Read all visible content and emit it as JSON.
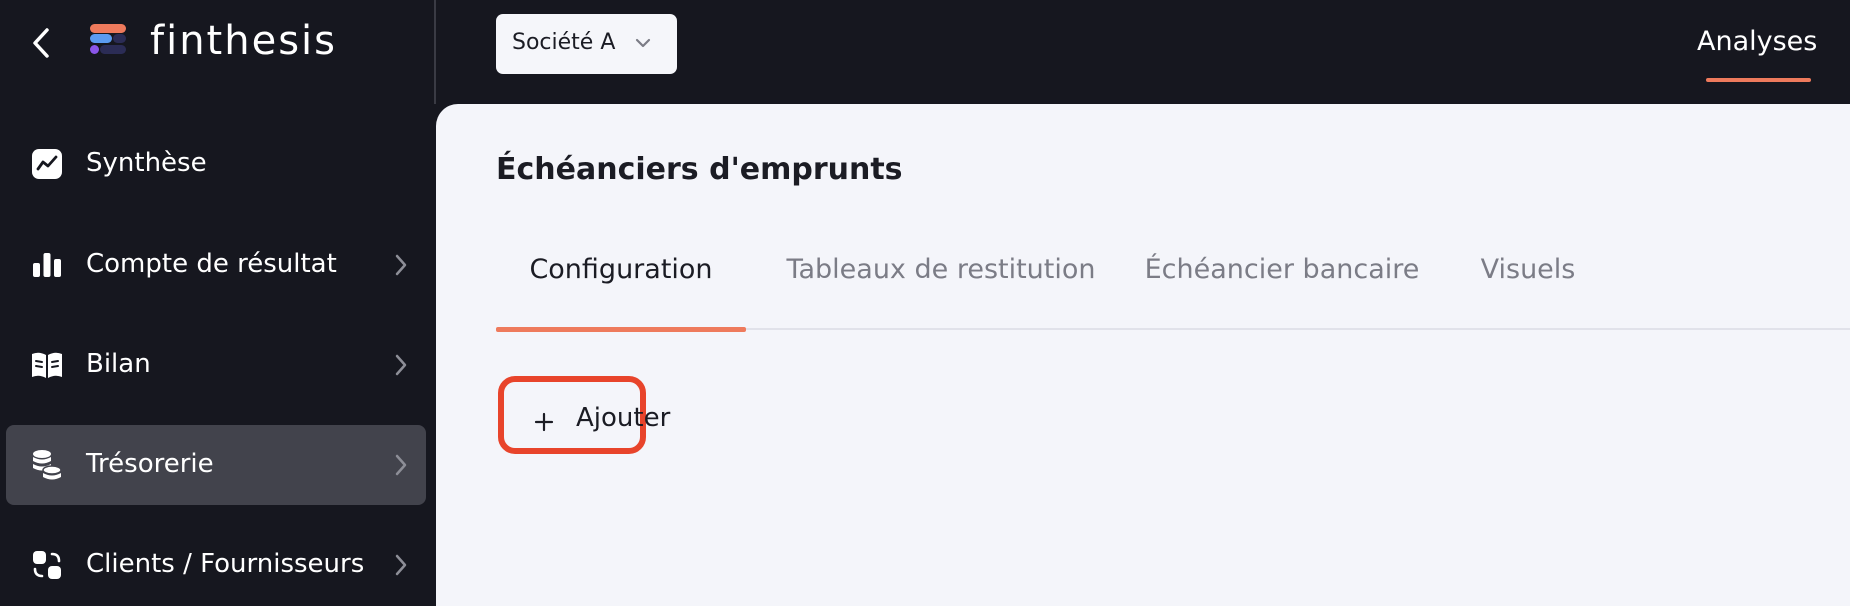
{
  "brand": {
    "name": "finthesis"
  },
  "header": {
    "company_select": {
      "value": "Société A"
    },
    "nav_right": {
      "label": "Analyses"
    }
  },
  "sidebar": {
    "items": [
      {
        "label": "Synthèse",
        "icon": "chart-line-icon",
        "has_chevron": false,
        "active": false
      },
      {
        "label": "Compte de résultat",
        "icon": "bar-chart-icon",
        "has_chevron": true,
        "active": false
      },
      {
        "label": "Bilan",
        "icon": "book-icon",
        "has_chevron": true,
        "active": false
      },
      {
        "label": "Trésorerie",
        "icon": "coins-icon",
        "has_chevron": true,
        "active": true
      },
      {
        "label": "Clients / Fournisseurs",
        "icon": "exchange-icon",
        "has_chevron": true,
        "active": false
      }
    ]
  },
  "main": {
    "title": "Échéanciers d'emprunts",
    "tabs": [
      {
        "label": "Configuration",
        "active": true
      },
      {
        "label": "Tableaux de restitution",
        "active": false
      },
      {
        "label": "Échéancier bancaire",
        "active": false
      },
      {
        "label": "Visuels",
        "active": false
      }
    ],
    "add_button": {
      "label": "Ajouter"
    }
  },
  "colors": {
    "dark_bg": "#16171f",
    "panel_bg": "#f4f5fa",
    "accent": "#ee7a5c",
    "highlight_border": "#e8442b",
    "active_nav_bg": "#42434c"
  }
}
